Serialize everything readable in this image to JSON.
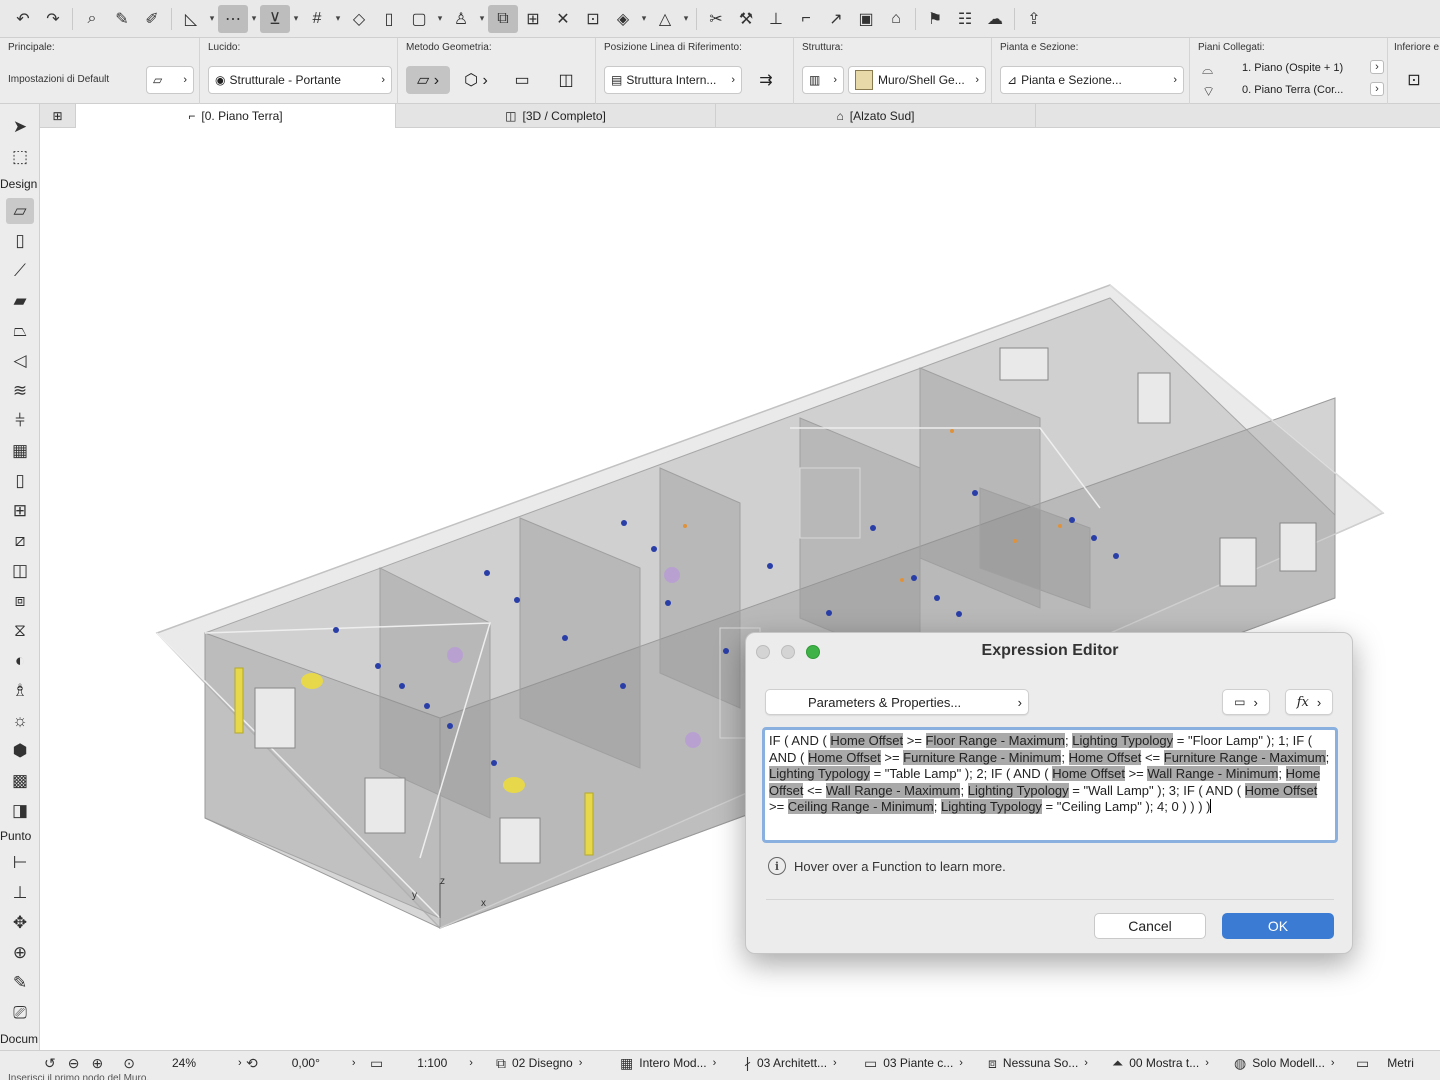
{
  "toolbar": {
    "buttons": [
      "undo-icon",
      "redo-icon",
      "find-select-icon",
      "eyedropper-icon",
      "syringe-icon",
      "measure-icon",
      "guide-line-icon",
      "snap-icon",
      "grid-icon",
      "shape-icon",
      "trace-icon",
      "suspend-groups-icon",
      "layer-icon",
      "line-icon",
      "rotate-icon",
      "stretch-icon",
      "mirror-icon",
      "magic-wand-icon",
      "cut-icon",
      "wrench-icon",
      "elevate-icon",
      "corner-icon",
      "fillet-icon",
      "split-icon",
      "roof-icon",
      "flag-icon",
      "table-icon",
      "cloud-sync-icon",
      "teamwork-icon"
    ]
  },
  "infobox": {
    "principale_label": "Principale:",
    "principale_value": "Impostazioni di Default",
    "lucido_label": "Lucido:",
    "lucido_value": "Strutturale - Portante",
    "metodo_label": "Metodo Geometria:",
    "posizione_label": "Posizione Linea di Riferimento:",
    "posizione_value": "Struttura Intern...",
    "struttura_label": "Struttura:",
    "struttura_value": "Muro/Shell Ge...",
    "pianta_label": "Pianta e Sezione:",
    "pianta_value": "Pianta e Sezione...",
    "piani_label": "Piani Collegati:",
    "piano_top": "1. Piano (Ospite + 1)",
    "piano_bottom": "0. Piano Terra (Cor...",
    "inferiore_label": "Inferiore e"
  },
  "toolbox": {
    "group_design": "Design",
    "group_punto": "Punto",
    "group_docum": "Docum"
  },
  "tabs": [
    {
      "label": "[0. Piano Terra]"
    },
    {
      "label": "[3D / Completo]"
    },
    {
      "label": "[Alzato Sud]"
    }
  ],
  "canvas": {
    "axis_z": "z",
    "axis_y": "y",
    "axis_x": "x"
  },
  "dialog": {
    "title": "Expression Editor",
    "params_button": "Parameters & Properties...",
    "hover_hint": "Hover over a Function to learn more.",
    "cancel": "Cancel",
    "ok": "OK",
    "expression": [
      {
        "t": "IF ( AND ( ",
        "h": false
      },
      {
        "t": "Home Offset",
        "h": true
      },
      {
        "t": " >= ",
        "h": false
      },
      {
        "t": "Floor Range - Maximum",
        "h": true
      },
      {
        "t": "; ",
        "h": false
      },
      {
        "t": "Lighting Typology",
        "h": true
      },
      {
        "t": " = \"Floor Lamp\" ); 1; IF ( AND ( ",
        "h": false
      },
      {
        "t": "Home Offset",
        "h": true
      },
      {
        "t": " >= ",
        "h": false
      },
      {
        "t": "Furniture Range - Minimum",
        "h": true
      },
      {
        "t": "; ",
        "h": false
      },
      {
        "t": "Home Offset",
        "h": true
      },
      {
        "t": " <= ",
        "h": false
      },
      {
        "t": "Furniture Range - Maximum",
        "h": true
      },
      {
        "t": "; ",
        "h": false
      },
      {
        "t": "Lighting Typology",
        "h": true
      },
      {
        "t": " = \"Table Lamp\" ); 2; IF ( AND ( ",
        "h": false
      },
      {
        "t": "Home Offset",
        "h": true
      },
      {
        "t": " >= ",
        "h": false
      },
      {
        "t": "Wall Range - Minimum",
        "h": true
      },
      {
        "t": "; ",
        "h": false
      },
      {
        "t": "Home Offset",
        "h": true
      },
      {
        "t": " <= ",
        "h": false
      },
      {
        "t": "Wall Range - Maximum",
        "h": true
      },
      {
        "t": "; ",
        "h": false
      },
      {
        "t": "Lighting Typology",
        "h": true
      },
      {
        "t": " = \"Wall Lamp\" ); 3; IF ( AND ( ",
        "h": false
      },
      {
        "t": "Home Offset",
        "h": true
      },
      {
        "t": " >= ",
        "h": false
      },
      {
        "t": "Ceiling Range - Minimum",
        "h": true
      },
      {
        "t": "; ",
        "h": false
      },
      {
        "t": "Lighting Typology",
        "h": true
      },
      {
        "t": " = \"Ceiling Lamp\" ); 4; 0 ) ) ) )",
        "h": false
      }
    ]
  },
  "statusbar": {
    "zoom": "24%",
    "angle": "0,00°",
    "scale": "1:100",
    "layer_combo": "02 Disegno",
    "model_view": "Intero Mod...",
    "pen_set": "03 Architett...",
    "mvo": "03 Piante c...",
    "renovation": "Nessuna So...",
    "renovation_filter": "00 Mostra t...",
    "structure_display": "Solo Modell...",
    "units": "Metri"
  },
  "hint": {
    "text": "Inserisci il primo nodo del Muro."
  },
  "colors": {
    "accent": "#3b7bd4",
    "highlight": "#a9a9a9",
    "traffic_close": "#d4d4d4",
    "traffic_min": "#d4d4d4",
    "traffic_max": "#3fb247"
  }
}
